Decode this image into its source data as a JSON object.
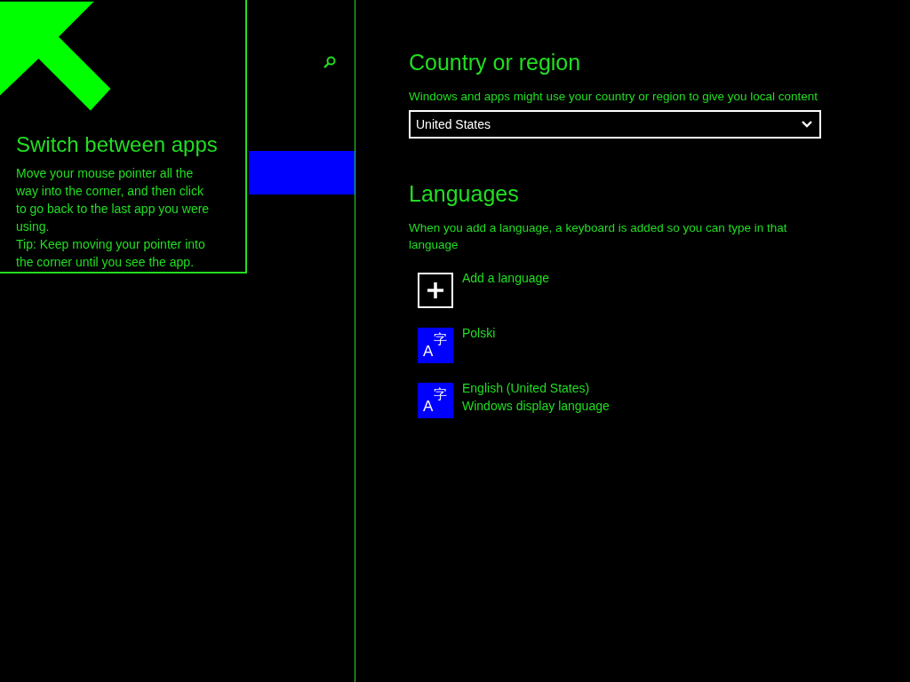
{
  "sidebar": {
    "highlight": {
      "selected": true
    }
  },
  "tip": {
    "title": "Switch between apps",
    "lines": [
      "Move your mouse pointer all the way into the corner, and then click to go back to the last app you were using.",
      "Tip: Keep moving your pointer into the corner until you see the app."
    ]
  },
  "country": {
    "heading": "Country or region",
    "description": "Windows and apps might use your country or region to give you local content",
    "value": "United States"
  },
  "languages": {
    "heading": "Languages",
    "description": "When you add a language, a keyboard is added so you can type in that language",
    "items": [
      {
        "kind": "add",
        "label": "Add a language"
      },
      {
        "kind": "language",
        "label": "Polski",
        "glyph": "A",
        "glyph_raised": "字"
      },
      {
        "kind": "language",
        "label": "English (United States)",
        "sublabel": "Windows display language",
        "glyph": "A",
        "glyph_raised": "字"
      }
    ]
  }
}
